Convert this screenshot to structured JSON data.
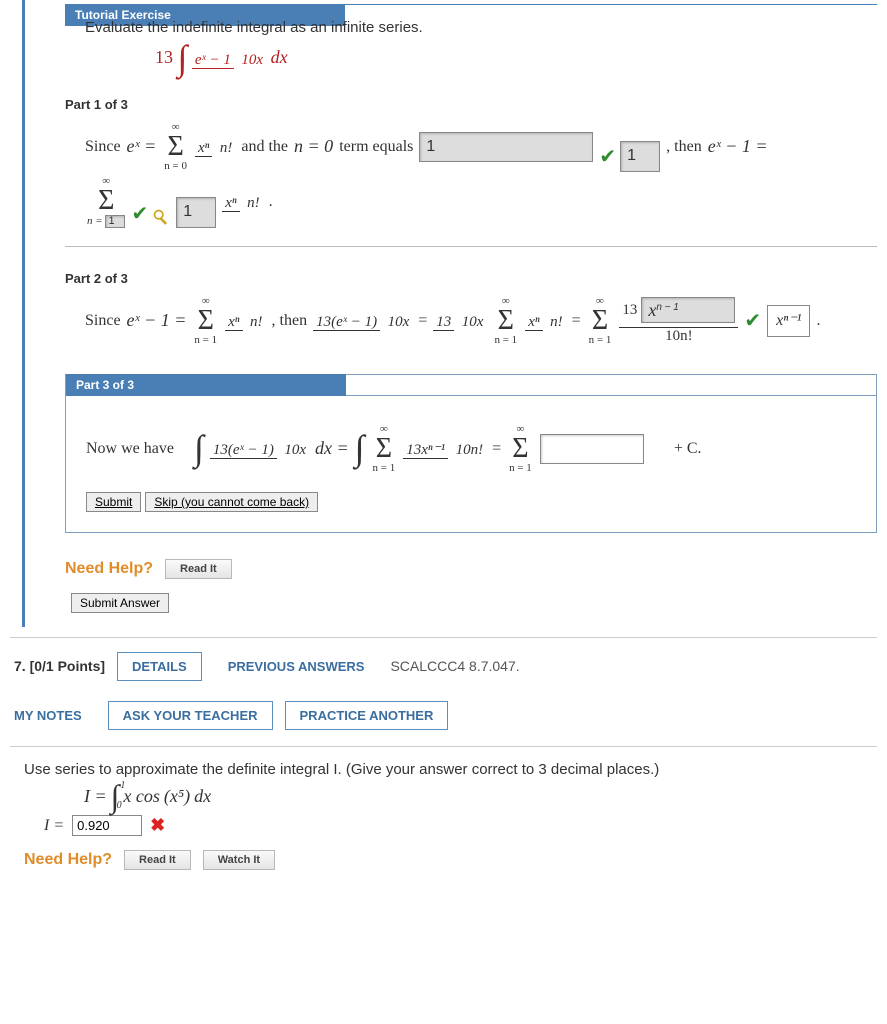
{
  "tutorial": {
    "header": "Tutorial Exercise",
    "prompt": "Evaluate the indefinite integral as an infinite series.",
    "integral_coef": "13",
    "integral_num": "eˣ − 1",
    "integral_den": "10x",
    "integral_dx": "dx"
  },
  "part1": {
    "label": "Part 1 of 3",
    "text_since": "Since ",
    "ex_eq": "eˣ =",
    "sum_top": "∞",
    "sum_bot": "n = 0",
    "frac_num": "xⁿ",
    "frac_den": "n!",
    "text_and": " and the ",
    "text_term": " term equals ",
    "n_eq": "n = 0",
    "ans1": "1",
    "ans2": "1",
    "text_then": ", then ",
    "ex_minus1": "eˣ − 1 =",
    "sum2_top": "∞",
    "n_equals": "n = ",
    "ans3": "1",
    "frac2_num": "xⁿ",
    "frac2_den": "n!",
    "key_ans": "1"
  },
  "part2": {
    "label": "Part 2 of 3",
    "text_since": "Since ",
    "ex_minus1": "eˣ − 1 =",
    "sum1_top": "∞",
    "sum1_bot": "n = 1",
    "frac1_num": "xⁿ",
    "frac1_den": "n!",
    "text_then": ", then ",
    "mid_num": "13(eˣ − 1)",
    "mid_den": "10x",
    "eq": " = ",
    "coef_num": "13",
    "coef_den": "10x",
    "sum2_top": "∞",
    "sum2_bot": "n = 1",
    "sum3_top": "∞",
    "sum3_bot": "n = 1",
    "ans_coef": "13",
    "ans_num": "xⁿ⁻¹",
    "n_minus1_display": "n − 1",
    "ans_den": "10n!",
    "formula_box": "xⁿ⁻¹"
  },
  "part3": {
    "header": "Part 3 of 3",
    "text_now": "Now we have",
    "lhs_num": "13(eˣ − 1)",
    "lhs_den": "10x",
    "dx": "dx =",
    "sum1_top": "∞",
    "sum1_bot": "n = 1",
    "mid_num": "13xⁿ⁻¹",
    "mid_den": "10n!",
    "sum2_top": "∞",
    "sum2_bot": "n = 1",
    "plus_c": "+ C.",
    "submit": "Submit",
    "skip": "Skip (you cannot come back)"
  },
  "help": {
    "label": "Need Help?",
    "read": "Read It",
    "watch": "Watch It"
  },
  "submit_answer": "Submit Answer",
  "q7": {
    "points": "7. [0/1 Points]",
    "details": "DETAILS",
    "previous": "PREVIOUS ANSWERS",
    "source": "SCALCCC4 8.7.047.",
    "notes": "MY NOTES",
    "ask": "ASK YOUR TEACHER",
    "practice": "PRACTICE ANOTHER",
    "prompt": "Use series to approximate the definite integral I. (Give your answer correct to 3 decimal places.)",
    "I_eq": "I =",
    "int_lower": "0",
    "int_upper": "1",
    "integrand_x": "x cos",
    "integrand_arg": "(x⁵)",
    "integrand_dx": "dx",
    "ans_label": "I =",
    "ans_value": "0.920"
  }
}
